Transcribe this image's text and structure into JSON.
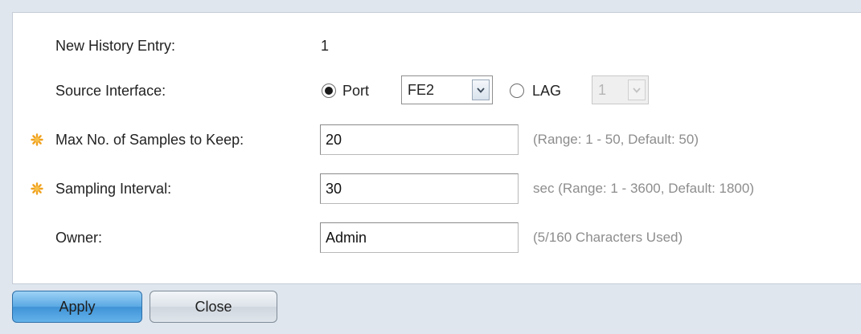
{
  "form": {
    "history_entry": {
      "label": "New History Entry:",
      "value": "1"
    },
    "source_interface": {
      "label": "Source Interface:",
      "port_label": "Port",
      "port_selected": true,
      "port_value": "FE2",
      "lag_label": "LAG",
      "lag_selected": false,
      "lag_value": "1",
      "lag_disabled": true
    },
    "max_samples": {
      "label": "Max No. of Samples to Keep:",
      "value": "20",
      "hint": "(Range: 1 - 50, Default: 50)",
      "required": true
    },
    "sampling_interval": {
      "label": "Sampling Interval:",
      "value": "30",
      "hint": "sec (Range: 1 - 3600, Default: 1800)",
      "required": true
    },
    "owner": {
      "label": "Owner:",
      "value": "Admin",
      "hint": "(5/160 Characters Used)"
    }
  },
  "buttons": {
    "apply_label": "Apply",
    "close_label": "Close"
  },
  "icons": {
    "required": "required-field-asterisk-icon",
    "dropdown": "chevron-down-icon"
  },
  "colors": {
    "page_background": "#dfe6ee",
    "panel_background": "#ffffff",
    "hint_text": "#8d8d8d",
    "required_icon": "#f0a21e",
    "apply_button": "#5aa8e4",
    "close_button": "#dde3ea"
  }
}
